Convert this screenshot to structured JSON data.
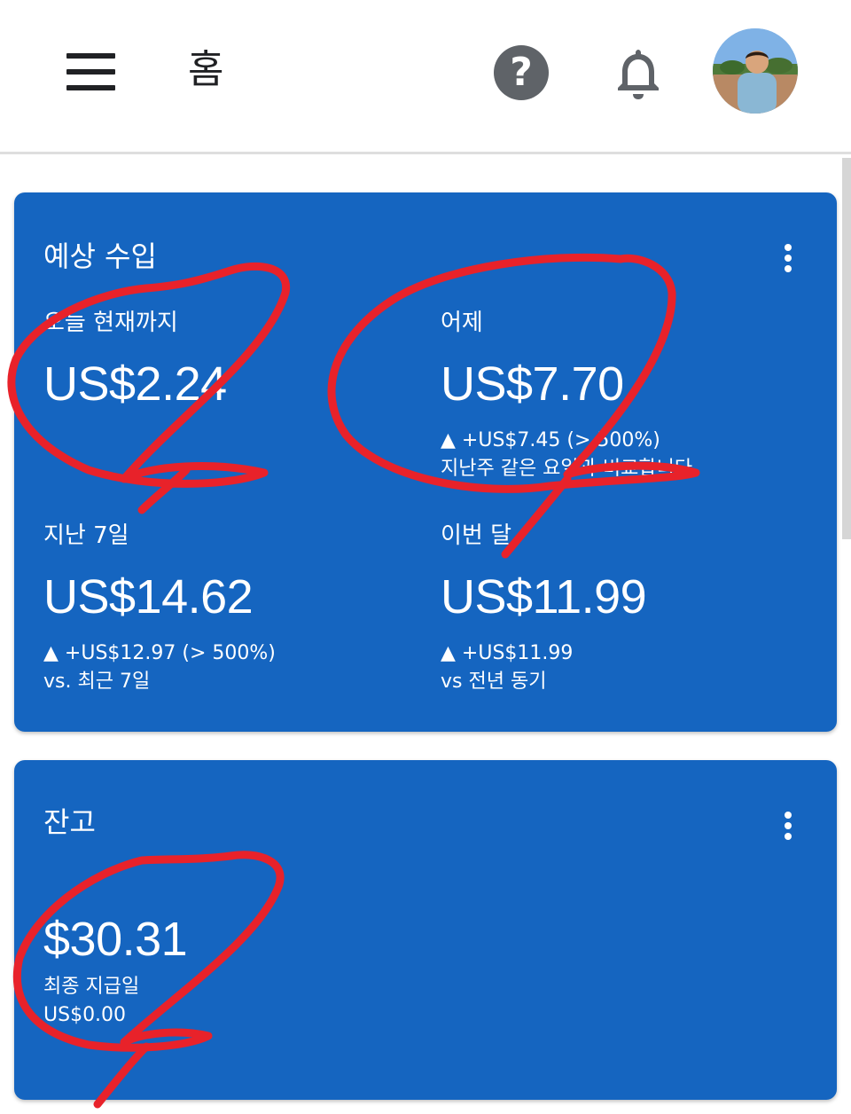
{
  "header": {
    "page_title": "홈"
  },
  "earnings": {
    "title": "예상 수입",
    "today": {
      "label": "오늘 현재까지",
      "value": "US$2.24"
    },
    "yesterday": {
      "label": "어제",
      "value": "US$7.70",
      "change": "▲ +US$7.45 (> 500%)",
      "note": "지난주 같은 요일과 비교합니다."
    },
    "last7": {
      "label": "지난 7일",
      "value": "US$14.62",
      "change": "▲ +US$12.97 (> 500%)",
      "note": "vs. 최근 7일"
    },
    "month": {
      "label": "이번 달",
      "value": "US$11.99",
      "change": "▲ +US$11.99",
      "note": "vs 전년 동기"
    }
  },
  "balance": {
    "title": "잔고",
    "value": "$30.31",
    "payment_label": "최종 지급일",
    "payment_value": "US$0.00"
  },
  "colors": {
    "card_bg": "#1565c0",
    "annotation": "#e8222a"
  }
}
